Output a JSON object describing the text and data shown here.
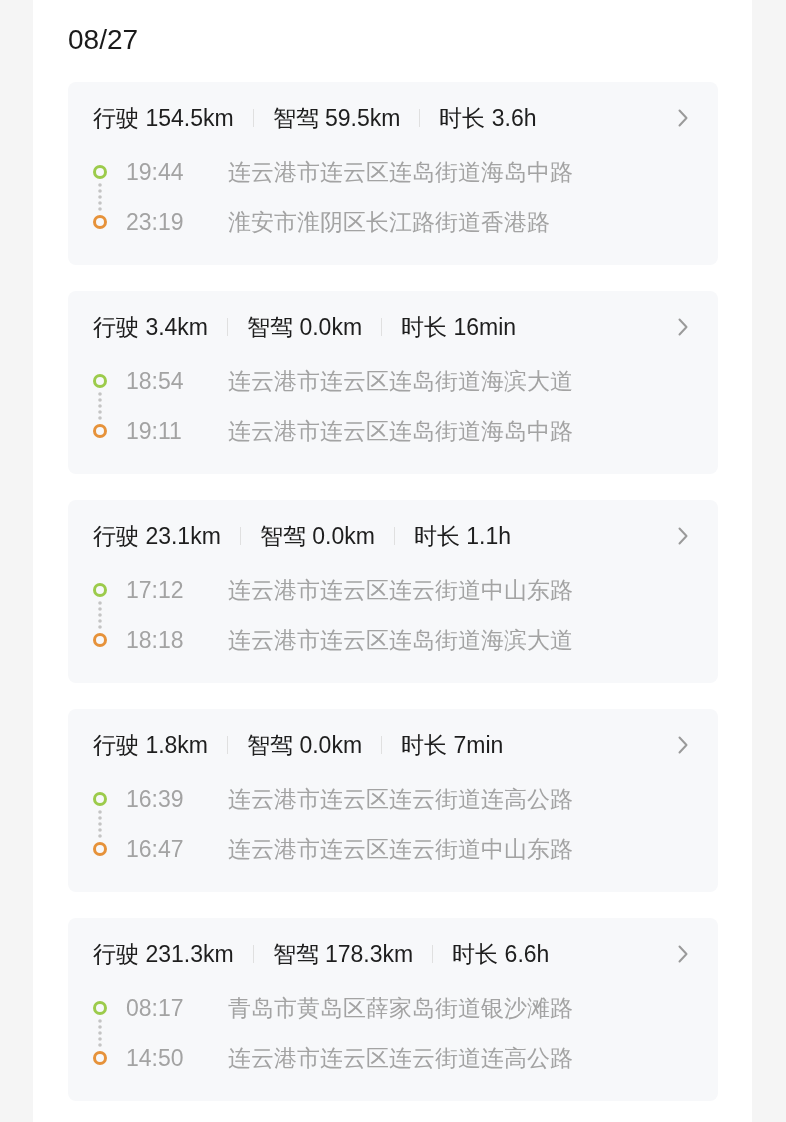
{
  "date": "08/27",
  "trips": [
    {
      "stats": [
        "行驶 154.5km",
        "智驾 59.5km",
        "时长 3.6h"
      ],
      "points": [
        {
          "color": "#9ccb4b",
          "time": "19:44",
          "address": "连云港市连云区连岛街道海岛中路"
        },
        {
          "color": "#e6923a",
          "time": "23:19",
          "address": "淮安市淮阴区长江路街道香港路"
        }
      ]
    },
    {
      "stats": [
        "行驶 3.4km",
        "智驾 0.0km",
        "时长 16min"
      ],
      "points": [
        {
          "color": "#9ccb4b",
          "time": "18:54",
          "address": "连云港市连云区连岛街道海滨大道"
        },
        {
          "color": "#e6923a",
          "time": "19:11",
          "address": "连云港市连云区连岛街道海岛中路"
        }
      ]
    },
    {
      "stats": [
        "行驶 23.1km",
        "智驾 0.0km",
        "时长 1.1h"
      ],
      "points": [
        {
          "color": "#9ccb4b",
          "time": "17:12",
          "address": "连云港市连云区连云街道中山东路"
        },
        {
          "color": "#e6923a",
          "time": "18:18",
          "address": "连云港市连云区连岛街道海滨大道"
        }
      ]
    },
    {
      "stats": [
        "行驶 1.8km",
        "智驾 0.0km",
        "时长 7min"
      ],
      "points": [
        {
          "color": "#9ccb4b",
          "time": "16:39",
          "address": "连云港市连云区连云街道连高公路"
        },
        {
          "color": "#e6923a",
          "time": "16:47",
          "address": "连云港市连云区连云街道中山东路"
        }
      ]
    },
    {
      "stats": [
        "行驶 231.3km",
        "智驾 178.3km",
        "时长 6.6h"
      ],
      "points": [
        {
          "color": "#9ccb4b",
          "time": "08:17",
          "address": "青岛市黄岛区薛家岛街道银沙滩路"
        },
        {
          "color": "#e6923a",
          "time": "14:50",
          "address": "连云港市连云区连云街道连高公路"
        }
      ]
    }
  ]
}
